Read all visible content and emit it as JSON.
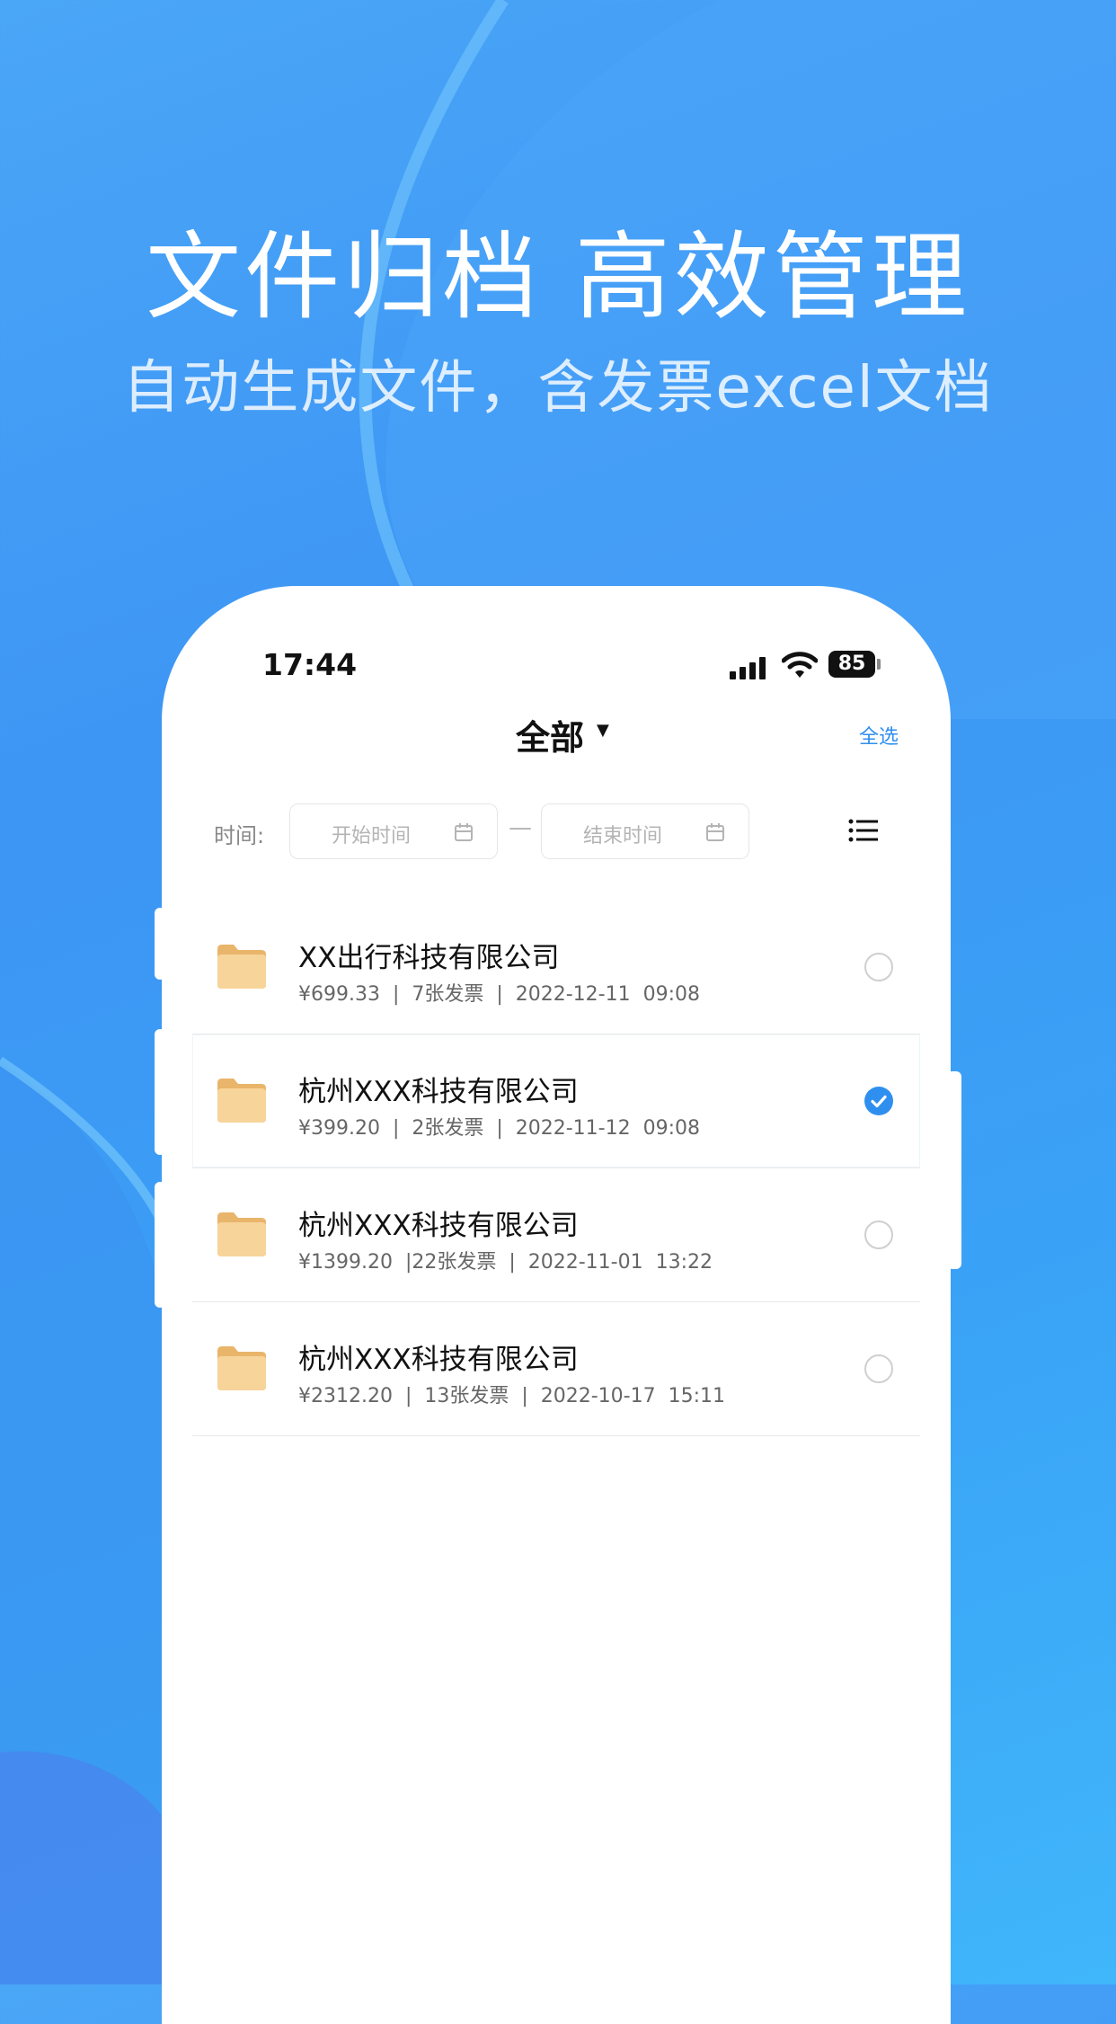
{
  "promo": {
    "headline": "文件归档 高效管理",
    "subheadline": "自动生成文件，含发票excel文档"
  },
  "status_bar": {
    "time": "17:44",
    "battery": "85"
  },
  "nav": {
    "title": "全部",
    "select_all": "全选"
  },
  "filter": {
    "label": "时间:",
    "start_placeholder": "开始时间",
    "separator": "—",
    "end_placeholder": "结束时间"
  },
  "files": [
    {
      "name": "XX出行科技有限公司",
      "meta": "¥699.33  |  7张发票  |  2022-12-11  09:08",
      "selected": false
    },
    {
      "name": "杭州XXX科技有限公司",
      "meta": "¥399.20  |  2张发票  |  2022-11-12  09:08",
      "selected": true
    },
    {
      "name": "杭州XXX科技有限公司",
      "meta": "¥1399.20  |22张发票  |  2022-11-01  13:22",
      "selected": false
    },
    {
      "name": "杭州XXX科技有限公司",
      "meta": "¥2312.20  |  13张发票  |  2022-10-17  15:11",
      "selected": false
    }
  ],
  "colors": {
    "accent": "#2f8fef",
    "background": "#3d95f4"
  }
}
